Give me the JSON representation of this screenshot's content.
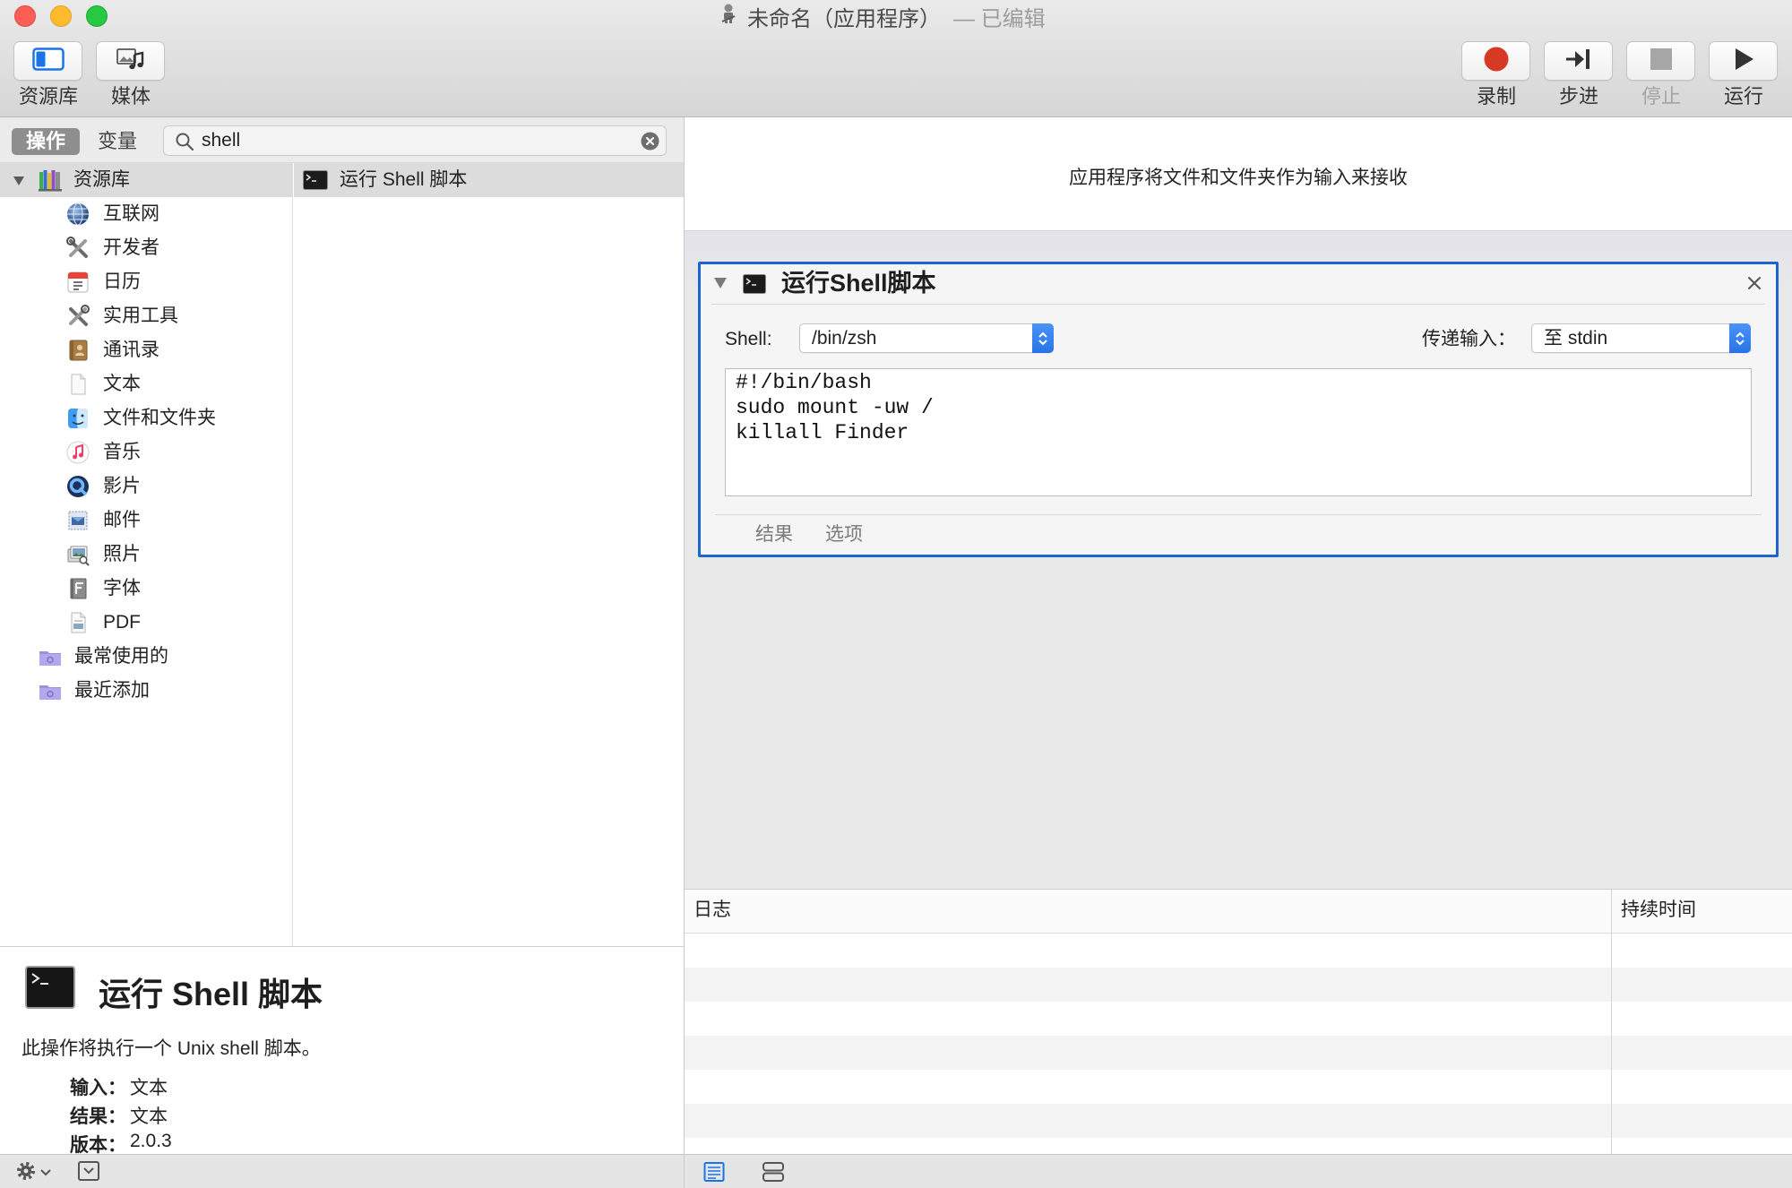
{
  "window": {
    "title": "未命名（应用程序）",
    "edited": "— 已编辑",
    "icon": "automator-robot-icon"
  },
  "toolbar": {
    "library": {
      "label": "资源库",
      "icon": "sidebar-icon"
    },
    "media": {
      "label": "媒体",
      "icon": "media-icon"
    },
    "record": {
      "label": "录制",
      "icon": "record-icon"
    },
    "step": {
      "label": "步进",
      "icon": "step-icon"
    },
    "stop": {
      "label": "停止",
      "icon": "stop-icon",
      "enabled": false
    },
    "run": {
      "label": "运行",
      "icon": "run-icon"
    }
  },
  "library": {
    "tabs": [
      {
        "label": "操作",
        "selected": true
      },
      {
        "label": "变量",
        "selected": false
      }
    ],
    "search": {
      "value": "shell",
      "icon": "search-icon"
    },
    "root": {
      "label": "资源库",
      "icon": "library-books-icon",
      "expanded": true
    },
    "items": [
      {
        "label": "互联网",
        "icon": "globe-icon"
      },
      {
        "label": "开发者",
        "icon": "developer-tools-icon"
      },
      {
        "label": "日历",
        "icon": "calendar-icon"
      },
      {
        "label": "实用工具",
        "icon": "utilities-tools-icon"
      },
      {
        "label": "通讯录",
        "icon": "contacts-icon"
      },
      {
        "label": "文本",
        "icon": "text-document-icon"
      },
      {
        "label": "文件和文件夹",
        "icon": "finder-icon"
      },
      {
        "label": "音乐",
        "icon": "music-icon"
      },
      {
        "label": "影片",
        "icon": "quicktime-icon"
      },
      {
        "label": "邮件",
        "icon": "mail-icon"
      },
      {
        "label": "照片",
        "icon": "photos-icon"
      },
      {
        "label": "字体",
        "icon": "font-book-icon"
      },
      {
        "label": "PDF",
        "icon": "pdf-icon"
      }
    ],
    "smart_groups": [
      {
        "label": "最常使用的",
        "icon": "smart-folder-icon"
      },
      {
        "label": "最近添加",
        "icon": "smart-folder-icon"
      }
    ],
    "results": [
      {
        "label": "运行 Shell 脚本",
        "icon": "terminal-icon"
      }
    ]
  },
  "description": {
    "title": "运行 Shell 脚本",
    "summary": "此操作将执行一个 Unix shell 脚本。",
    "fields": [
      {
        "label": "输入：",
        "value": "文本"
      },
      {
        "label": "结果：",
        "value": "文本"
      },
      {
        "label": "版本：",
        "value": "2.0.3"
      }
    ]
  },
  "workflow": {
    "input_note": "应用程序将文件和文件夹作为输入来接收",
    "action": {
      "title": "运行Shell脚本",
      "shell_label": "Shell:",
      "shell_value": "/bin/zsh",
      "pass_label": "传递输入：",
      "pass_value": "至 stdin",
      "script_lines": [
        "#!/bin/bash",
        "sudo mount -uw /",
        "killall Finder"
      ],
      "tabs": [
        "结果",
        "选项"
      ]
    }
  },
  "log": {
    "columns": [
      "日志",
      "持续时间"
    ]
  },
  "colors": {
    "accent": "#1c64d2",
    "record": "#d63a24",
    "selection": "#dcdcdc"
  }
}
